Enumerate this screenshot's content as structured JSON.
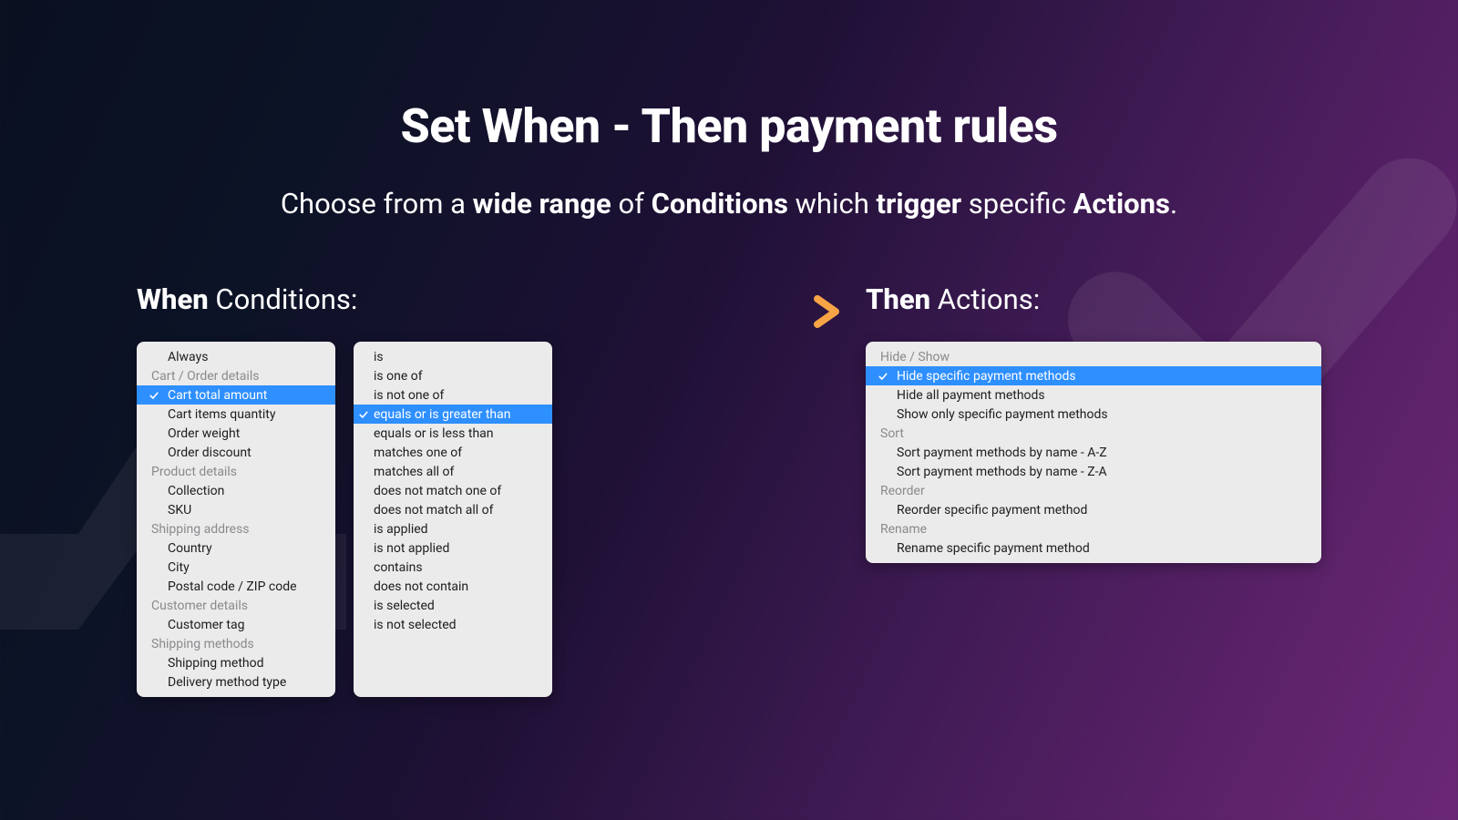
{
  "hero": {
    "title": "Set When - Then payment rules",
    "subtitle_prefix": "Choose from a ",
    "subtitle_b1": "wide range",
    "subtitle_mid1": " of ",
    "subtitle_b2": "Conditions",
    "subtitle_mid2": " which ",
    "subtitle_b3": "trigger",
    "subtitle_mid3": " specific ",
    "subtitle_b4": "Actions",
    "subtitle_suffix": "."
  },
  "when": {
    "heading_bold": "When",
    "heading_rest": " Conditions:",
    "conditions_panel": {
      "groups": [
        {
          "header": null,
          "items": [
            {
              "label": "Always",
              "selected": false
            }
          ]
        },
        {
          "header": "Cart / Order details",
          "items": [
            {
              "label": "Cart total amount",
              "selected": true
            },
            {
              "label": "Cart items quantity",
              "selected": false
            },
            {
              "label": "Order weight",
              "selected": false
            },
            {
              "label": "Order discount",
              "selected": false
            }
          ]
        },
        {
          "header": "Product details",
          "items": [
            {
              "label": "Collection",
              "selected": false
            },
            {
              "label": "SKU",
              "selected": false
            }
          ]
        },
        {
          "header": "Shipping address",
          "items": [
            {
              "label": "Country",
              "selected": false
            },
            {
              "label": "City",
              "selected": false
            },
            {
              "label": "Postal code / ZIP code",
              "selected": false
            }
          ]
        },
        {
          "header": "Customer details",
          "items": [
            {
              "label": "Customer tag",
              "selected": false
            }
          ]
        },
        {
          "header": "Shipping methods",
          "items": [
            {
              "label": "Shipping method",
              "selected": false
            },
            {
              "label": "Delivery method type",
              "selected": false
            }
          ]
        }
      ]
    },
    "operators_panel": {
      "items": [
        {
          "label": "is",
          "selected": false
        },
        {
          "label": "is one of",
          "selected": false
        },
        {
          "label": "is not one of",
          "selected": false
        },
        {
          "label": "equals or is greater than",
          "selected": true
        },
        {
          "label": "equals or is less than",
          "selected": false
        },
        {
          "label": "matches one of",
          "selected": false
        },
        {
          "label": "matches all of",
          "selected": false
        },
        {
          "label": "does not match one of",
          "selected": false
        },
        {
          "label": "does not match all of",
          "selected": false
        },
        {
          "label": "is applied",
          "selected": false
        },
        {
          "label": "is not applied",
          "selected": false
        },
        {
          "label": "contains",
          "selected": false
        },
        {
          "label": "does not contain",
          "selected": false
        },
        {
          "label": "is selected",
          "selected": false
        },
        {
          "label": "is not selected",
          "selected": false
        }
      ]
    }
  },
  "then": {
    "heading_bold": "Then",
    "heading_rest": " Actions:",
    "actions_panel": {
      "groups": [
        {
          "header": "Hide / Show",
          "items": [
            {
              "label": "Hide specific payment methods",
              "selected": true
            },
            {
              "label": "Hide all payment methods",
              "selected": false
            },
            {
              "label": "Show only specific payment methods",
              "selected": false
            }
          ]
        },
        {
          "header": "Sort",
          "items": [
            {
              "label": "Sort payment methods by name - A-Z",
              "selected": false
            },
            {
              "label": "Sort payment methods by name - Z-A",
              "selected": false
            }
          ]
        },
        {
          "header": "Reorder",
          "items": [
            {
              "label": "Reorder specific payment method",
              "selected": false
            }
          ]
        },
        {
          "header": "Rename",
          "items": [
            {
              "label": "Rename specific payment method",
              "selected": false
            }
          ]
        }
      ]
    }
  },
  "colors": {
    "selection": "#2e8fff",
    "arrow_start": "#e63b5c",
    "arrow_end": "#f6a445"
  }
}
